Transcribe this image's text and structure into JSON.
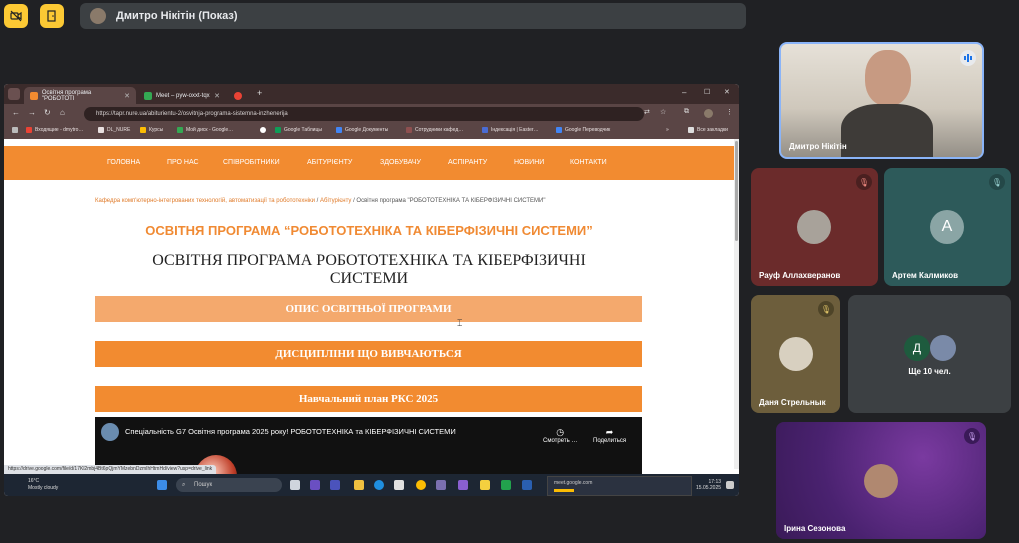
{
  "meet": {
    "presenter_label": "Дмитро Нікітін (Показ)",
    "more_label": "Ще 10 чел.",
    "participants": [
      {
        "name": "Дмитро Нікітін"
      },
      {
        "name": "Рауф Аллахверанов"
      },
      {
        "name": "Артем Калмиков",
        "initial": "A"
      },
      {
        "name": "Даня Стрельнык"
      },
      {
        "name": "Ірина Сезонова"
      }
    ],
    "more_initial": "Д"
  },
  "browser": {
    "tabs": [
      {
        "label": "Освітня програма \"РОБОТОТІ"
      },
      {
        "label": "Meet – pyw-oxxt-tqx"
      }
    ],
    "url": "https://tapr.nure.ua/abiturientu-2/osvitnja-programa-sistemna-inzhenerija",
    "bookmarks": [
      "Входящие - dmytro…",
      "DL_NURE",
      "Курсы",
      "Мой диск - Google…",
      "Google Таблицы",
      "Google Документы",
      "Сотрудники кафед…",
      "Індексація | Easter…",
      "Google Переводчик"
    ],
    "all_bookmarks": "Все закладки",
    "status_url": "https://drive.google.com/file/d/17Kl2mbj4Bt6pQjmYMzebnDzmIhHtmHd/view?usp=drive_link"
  },
  "site": {
    "nav": [
      "ГОЛОВНА",
      "ПРО НАС",
      "СПІВРОБІТНИКИ",
      "АБІТУРІЄНТУ",
      "ЗДОБУВАЧУ",
      "АСПІРАНТУ",
      "НОВИНИ",
      "КОНТАКТИ"
    ],
    "breadcrumb": {
      "part1": "Кафедра комп'ютерно-інтегрованих технологій, автоматизації та робототехніки",
      "sep": "/",
      "part2": "Абітурієнту",
      "part3": "Освітня програма \"РОБОТОТЕХНІКА ТА КІБЕРФІЗИЧНІ СИСТЕМИ\""
    },
    "heading_orange": "ОСВІТНЯ ПРОГРАМА “РОБОТОТЕХНІКА ТА КІБЕРФІЗИЧНІ СИСТЕМИ”",
    "heading_serif_1": "ОСВІТНЯ ПРОГРАМА РОБОТОТЕХНІКА ТА КІБЕРФІЗИЧНІ",
    "heading_serif_2": "СИСТЕМИ",
    "buttons": [
      "ОПИС ОСВІТНЬОЇ ПРОГРАМИ",
      "ДИСЦИПЛІНИ ЩО ВИВЧАЮТЬСЯ",
      "Навчальний план РКС 2025"
    ],
    "video": {
      "title": "Спеціальність G7 Освітня програма 2025 року! РОБОТОТЕХНІКА та КІБЕРФІЗИЧНІ СИСТЕМИ",
      "watch_later": "Смотреть …",
      "share": "Поделиться"
    }
  },
  "taskbar": {
    "temp": "16°C",
    "weather": "Mostly cloudy",
    "search_placeholder": "Пошук",
    "meet_url": "meet.google.com",
    "time": "17:13",
    "date": "15.05.2025"
  },
  "colors": {
    "accent_orange": "#f28b30",
    "meet_yellow": "#fcc934",
    "tile_red": "#6b2b2b",
    "tile_teal": "#2d5a5a",
    "tile_olive": "#6d5e3c",
    "tile_purple": "#5a2b7a"
  }
}
